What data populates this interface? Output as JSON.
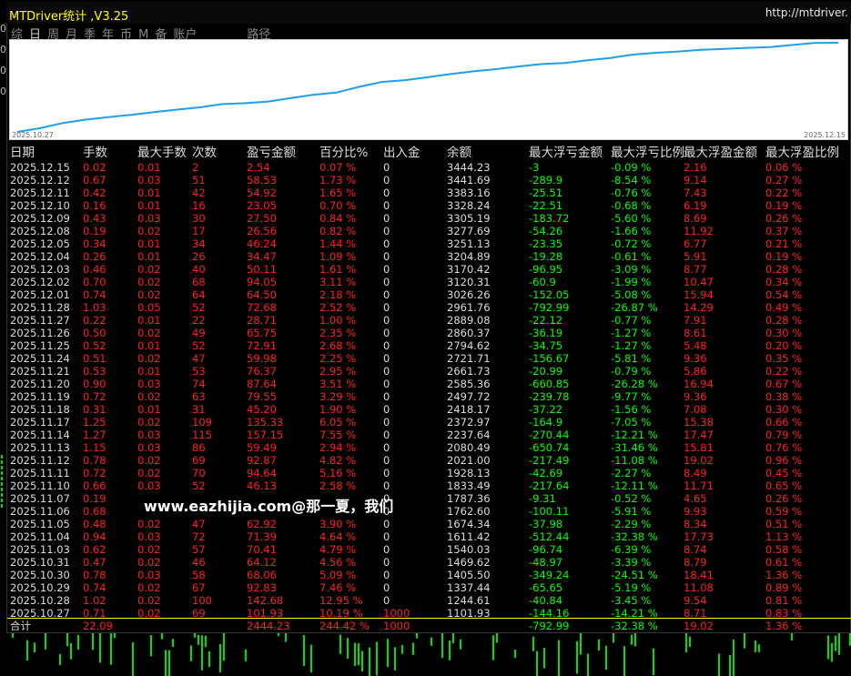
{
  "window": {
    "title": "MTDriver统计 ,V3.25",
    "url": "http://mtdriver."
  },
  "left_edge_labels": [
    "0",
    "0",
    "0",
    "0"
  ],
  "tabs": [
    "综",
    "日",
    "周",
    "月",
    "季",
    "年",
    "币",
    "M",
    "备",
    "账户",
    "路径"
  ],
  "active_tab": "日",
  "equity_chart": {
    "start_date": "2025.10.27",
    "end_date": "2025.12.15",
    "line_color": "#1ea0e8"
  },
  "columns": [
    "日期",
    "手数",
    "最大手数",
    "次数",
    "盈亏金额",
    "百分比%",
    "出入金",
    "余额",
    "最大浮亏金额",
    "最大浮亏比例",
    "最大浮盈金额",
    "最大浮盈比例"
  ],
  "rows": [
    [
      "2025.12.15",
      "0.02",
      "0.01",
      "2",
      "2.54",
      "0.07 %",
      "0",
      "3444.23",
      "-3",
      "-0.09 %",
      "2.16",
      "0.06 %"
    ],
    [
      "2025.12.12",
      "0.67",
      "0.03",
      "51",
      "58.53",
      "1.73 %",
      "0",
      "3441.69",
      "-289.9",
      "-8.54 %",
      "9.14",
      "0.27 %"
    ],
    [
      "2025.12.11",
      "0.42",
      "0.01",
      "42",
      "54.92",
      "1.65 %",
      "0",
      "3383.16",
      "-25.51",
      "-0.76 %",
      "7.43",
      "0.22 %"
    ],
    [
      "2025.12.10",
      "0.16",
      "0.01",
      "16",
      "23.05",
      "0.70 %",
      "0",
      "3328.24",
      "-22.51",
      "-0.68 %",
      "6.19",
      "0.19 %"
    ],
    [
      "2025.12.09",
      "0.43",
      "0.03",
      "30",
      "27.50",
      "0.84 %",
      "0",
      "3305.19",
      "-183.72",
      "-5.60 %",
      "8.69",
      "0.26 %"
    ],
    [
      "2025.12.08",
      "0.19",
      "0.02",
      "17",
      "26.56",
      "0.82 %",
      "0",
      "3277.69",
      "-54.26",
      "-1.66 %",
      "11.92",
      "0.37 %"
    ],
    [
      "2025.12.05",
      "0.34",
      "0.01",
      "34",
      "46.24",
      "1.44 %",
      "0",
      "3251.13",
      "-23.35",
      "-0.72 %",
      "6.77",
      "0.21 %"
    ],
    [
      "2025.12.04",
      "0.26",
      "0.01",
      "26",
      "34.47",
      "1.09 %",
      "0",
      "3204.89",
      "-19.28",
      "-0.61 %",
      "5.91",
      "0.19 %"
    ],
    [
      "2025.12.03",
      "0.46",
      "0.02",
      "40",
      "50.11",
      "1.61 %",
      "0",
      "3170.42",
      "-96.95",
      "-3.09 %",
      "8.77",
      "0.28 %"
    ],
    [
      "2025.12.02",
      "0.70",
      "0.02",
      "68",
      "94.05",
      "3.11 %",
      "0",
      "3120.31",
      "-60.9",
      "-1.99 %",
      "10.47",
      "0.34 %"
    ],
    [
      "2025.12.01",
      "0.74",
      "0.02",
      "64",
      "64.50",
      "2.18 %",
      "0",
      "3026.26",
      "-152.05",
      "-5.08 %",
      "15.94",
      "0.54 %"
    ],
    [
      "2025.11.28",
      "1.03",
      "0.05",
      "52",
      "72.68",
      "2.52 %",
      "0",
      "2961.76",
      "-792.99",
      "-26.87 %",
      "14.29",
      "0.49 %"
    ],
    [
      "2025.11.27",
      "0.22",
      "0.01",
      "22",
      "28.71",
      "1.00 %",
      "0",
      "2889.08",
      "-22.12",
      "-0.77 %",
      "7.91",
      "0.28 %"
    ],
    [
      "2025.11.26",
      "0.50",
      "0.02",
      "49",
      "65.75",
      "2.35 %",
      "0",
      "2860.37",
      "-36.19",
      "-1.27 %",
      "8.61",
      "0.30 %"
    ],
    [
      "2025.11.25",
      "0.52",
      "0.01",
      "52",
      "72.91",
      "2.68 %",
      "0",
      "2794.62",
      "-34.75",
      "-1.27 %",
      "5.48",
      "0.20 %"
    ],
    [
      "2025.11.24",
      "0.51",
      "0.02",
      "47",
      "59.98",
      "2.25 %",
      "0",
      "2721.71",
      "-156.67",
      "-5.81 %",
      "9.36",
      "0.35 %"
    ],
    [
      "2025.11.21",
      "0.53",
      "0.01",
      "53",
      "76.37",
      "2.95 %",
      "0",
      "2661.73",
      "-20.99",
      "-0.79 %",
      "5.86",
      "0.22 %"
    ],
    [
      "2025.11.20",
      "0.90",
      "0.03",
      "74",
      "87.64",
      "3.51 %",
      "0",
      "2585.36",
      "-660.85",
      "-26.28 %",
      "16.94",
      "0.67 %"
    ],
    [
      "2025.11.19",
      "0.72",
      "0.02",
      "63",
      "79.55",
      "3.29 %",
      "0",
      "2497.72",
      "-239.78",
      "-9.77 %",
      "9.36",
      "0.38 %"
    ],
    [
      "2025.11.18",
      "0.31",
      "0.01",
      "31",
      "45.20",
      "1.90 %",
      "0",
      "2418.17",
      "-37.22",
      "-1.56 %",
      "7.08",
      "0.30 %"
    ],
    [
      "2025.11.17",
      "1.25",
      "0.02",
      "109",
      "135.33",
      "6.05 %",
      "0",
      "2372.97",
      "-164.9",
      "-7.05 %",
      "15.38",
      "0.66 %"
    ],
    [
      "2025.11.14",
      "1.27",
      "0.03",
      "115",
      "157.15",
      "7.55 %",
      "0",
      "2237.64",
      "-270.44",
      "-12.21 %",
      "17.47",
      "0.79 %"
    ],
    [
      "2025.11.13",
      "1.15",
      "0.03",
      "86",
      "59.49",
      "2.94 %",
      "0",
      "2080.49",
      "-650.74",
      "-31.46 %",
      "15.81",
      "0.76 %"
    ],
    [
      "2025.11.12",
      "0.78",
      "0.02",
      "69",
      "92.87",
      "4.82 %",
      "0",
      "2021.00",
      "-217.49",
      "-11.08 %",
      "19.02",
      "0.96 %"
    ],
    [
      "2025.11.11",
      "0.72",
      "0.02",
      "70",
      "94.64",
      "5.16 %",
      "0",
      "1928.13",
      "-42.69",
      "-2.27 %",
      "8.49",
      "0.45 %"
    ],
    [
      "2025.11.10",
      "0.66",
      "0.03",
      "52",
      "46.13",
      "2.58 %",
      "0",
      "1833.49",
      "-217.64",
      "-12.11 %",
      "11.71",
      "0.65 %"
    ],
    [
      "2025.11.07",
      "0.19",
      "",
      "",
      "",
      "",
      "0",
      "1787.36",
      "-9.31",
      "-0.52 %",
      "4.65",
      "0.26 %"
    ],
    [
      "2025.11.06",
      "0.68",
      "",
      "",
      "",
      "",
      "0",
      "1762.60",
      "-100.11",
      "-5.91 %",
      "9.93",
      "0.59 %"
    ],
    [
      "2025.11.05",
      "0.48",
      "0.02",
      "47",
      "62.92",
      "3.90 %",
      "0",
      "1674.34",
      "-37.98",
      "-2.29 %",
      "8.34",
      "0.51 %"
    ],
    [
      "2025.11.04",
      "0.94",
      "0.03",
      "72",
      "71.39",
      "4.64 %",
      "0",
      "1611.42",
      "-512.44",
      "-32.38 %",
      "17.73",
      "1.13 %"
    ],
    [
      "2025.11.03",
      "0.62",
      "0.02",
      "57",
      "70.41",
      "4.79 %",
      "0",
      "1540.03",
      "-96.74",
      "-6.39 %",
      "8.74",
      "0.58 %"
    ],
    [
      "2025.10.31",
      "0.47",
      "0.02",
      "46",
      "64.12",
      "4.56 %",
      "0",
      "1469.62",
      "-48.97",
      "-3.39 %",
      "8.79",
      "0.61 %"
    ],
    [
      "2025.10.30",
      "0.78",
      "0.03",
      "58",
      "68.06",
      "5.09 %",
      "0",
      "1405.50",
      "-349.24",
      "-24.51 %",
      "18.41",
      "1.36 %"
    ],
    [
      "2025.10.29",
      "0.74",
      "0.02",
      "67",
      "92.83",
      "7.46 %",
      "0",
      "1337.44",
      "-65.65",
      "-5.19 %",
      "11.08",
      "0.89 %"
    ],
    [
      "2025.10.28",
      "1.02",
      "0.02",
      "100",
      "142.68",
      "12.95 %",
      "0",
      "1244.61",
      "-40.84",
      "-3.45 %",
      "9.54",
      "0.81 %"
    ],
    [
      "2025.10.27",
      "0.71",
      "0.02",
      "69",
      "101.93",
      "10.19 %",
      "1000",
      "1101.93",
      "-144.16",
      "-14.21 %",
      "8.71",
      "0.83 %"
    ]
  ],
  "totals": [
    "合计",
    "22.09",
    "",
    "",
    "2444.23",
    "244.42 %",
    "1000",
    "",
    "-792.99",
    "-32.38 %",
    "19.02",
    "1.36 %"
  ],
  "watermark": "www.eazhijia.com@那一夏，我们"
}
